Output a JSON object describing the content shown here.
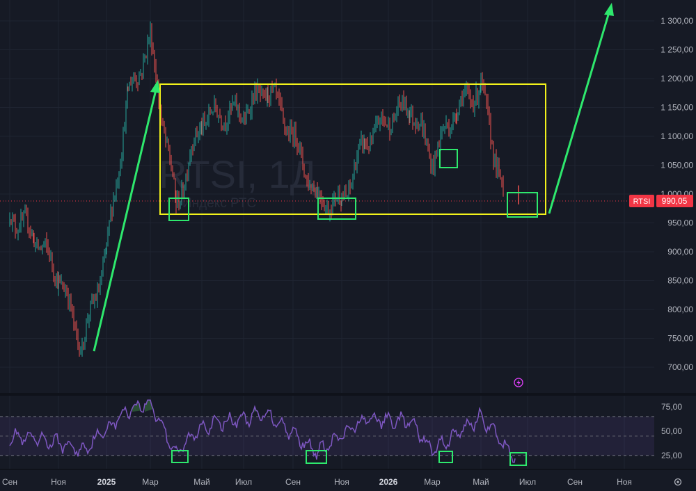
{
  "watermark": {
    "symbol": "RTSI, 1Д",
    "name": "Индекс РТС"
  },
  "price_badge": {
    "ticker": "RTSI",
    "value": "990,05"
  },
  "price_axis": {
    "ticks": [
      {
        "label": "1 300,00",
        "v": 1300
      },
      {
        "label": "1 250,00",
        "v": 1250
      },
      {
        "label": "1 200,00",
        "v": 1200
      },
      {
        "label": "1 150,00",
        "v": 1150
      },
      {
        "label": "1 100,00",
        "v": 1100
      },
      {
        "label": "1 050,00",
        "v": 1050
      },
      {
        "label": "1 000,00",
        "v": 1000
      },
      {
        "label": "950,00",
        "v": 950
      },
      {
        "label": "900,00",
        "v": 900
      },
      {
        "label": "850,00",
        "v": 850
      },
      {
        "label": "800,00",
        "v": 800
      },
      {
        "label": "750,00",
        "v": 750
      },
      {
        "label": "700,00",
        "v": 700
      }
    ]
  },
  "rsi_axis": {
    "ticks": [
      {
        "label": "75,00",
        "v": 75
      },
      {
        "label": "50,00",
        "v": 50
      },
      {
        "label": "25,00",
        "v": 25
      }
    ]
  },
  "time_axis": {
    "labels": [
      {
        "label": "Сен",
        "bold": false
      },
      {
        "label": "Ноя",
        "bold": false
      },
      {
        "label": "2025",
        "bold": true
      },
      {
        "label": "Мар",
        "bold": false
      },
      {
        "label": "Май",
        "bold": false
      },
      {
        "label": "Июл",
        "bold": false
      },
      {
        "label": "Сен",
        "bold": false
      },
      {
        "label": "Ноя",
        "bold": false
      },
      {
        "label": "2026",
        "bold": true
      },
      {
        "label": "Мар",
        "bold": false
      },
      {
        "label": "Май",
        "bold": false
      },
      {
        "label": "Июл",
        "bold": false
      },
      {
        "label": "Сен",
        "bold": false
      },
      {
        "label": "Ноя",
        "bold": false
      }
    ]
  },
  "colors": {
    "background": "#161a25",
    "grid": "#1f2431",
    "axis_text": "#b2b5be",
    "candle_up": "#26a69a",
    "candle_down": "#ef5350",
    "rsi_line": "#7e57c2",
    "rsi_band": "#7e57c2",
    "range_box": "#f2f21b",
    "trend_arrows": "#2ee86d",
    "markers": "#2ee86d",
    "badge": "#f23645",
    "price_line": "#f23645"
  },
  "icons": [
    "alert-bolt-icon",
    "settings-gear-icon"
  ],
  "chart_data": [
    {
      "type": "candlestick",
      "title": "RTSI, 1Д",
      "subtitle": "Индекс РТС",
      "ylim": [
        680,
        1320
      ],
      "last_value": 990.05,
      "x_axis": "monthly ticks from Сен 2024 to Ноя 2026",
      "approx_path": [
        {
          "x": "Сен 2024",
          "y": 965
        },
        {
          "x": "Окт 2024",
          "y": 930
        },
        {
          "x": "Ноя 2024",
          "y": 860
        },
        {
          "x": "Дек 2024",
          "y": 735
        },
        {
          "x": "Янв 2025",
          "y": 900
        },
        {
          "x": "Фев 2025",
          "y": 1170
        },
        {
          "x": "Мар 2025",
          "y": 1265
        },
        {
          "x": "Апр 2025",
          "y": 980
        },
        {
          "x": "Май 2025",
          "y": 1130
        },
        {
          "x": "Июн 2025",
          "y": 1140
        },
        {
          "x": "Июл 2025",
          "y": 1140
        },
        {
          "x": "Авг 2025",
          "y": 1185
        },
        {
          "x": "Сен 2025",
          "y": 1100
        },
        {
          "x": "Окт 2025",
          "y": 990
        },
        {
          "x": "Ноя 2025",
          "y": 985
        },
        {
          "x": "Дек 2025",
          "y": 1090
        },
        {
          "x": "Янв 2026",
          "y": 1130
        },
        {
          "x": "Фев 2026",
          "y": 1155
        },
        {
          "x": "Мар 2026",
          "y": 1060
        },
        {
          "x": "Апр 2026",
          "y": 1150
        },
        {
          "x": "Май 2026",
          "y": 1185
        },
        {
          "x": "Июн 2026",
          "y": 990
        }
      ]
    },
    {
      "type": "line",
      "name": "RSI",
      "ylim": [
        15,
        85
      ],
      "bands": [
        30,
        70
      ],
      "levels": [
        75,
        50,
        25
      ],
      "approx_path": [
        {
          "x": "Сен 2024",
          "y": 45
        },
        {
          "x": "Ноя 2024",
          "y": 38
        },
        {
          "x": "Дек 2024",
          "y": 30
        },
        {
          "x": "Фев 2025",
          "y": 72
        },
        {
          "x": "Мар 2025",
          "y": 80
        },
        {
          "x": "Апр 2025",
          "y": 27
        },
        {
          "x": "Май 2025",
          "y": 55
        },
        {
          "x": "Авг 2025",
          "y": 68
        },
        {
          "x": "Окт 2025",
          "y": 28
        },
        {
          "x": "Дек 2025",
          "y": 62
        },
        {
          "x": "Фев 2026",
          "y": 60
        },
        {
          "x": "Мар 2026",
          "y": 30
        },
        {
          "x": "Май 2026",
          "y": 65
        },
        {
          "x": "Июн 2026",
          "y": 22
        }
      ]
    }
  ]
}
